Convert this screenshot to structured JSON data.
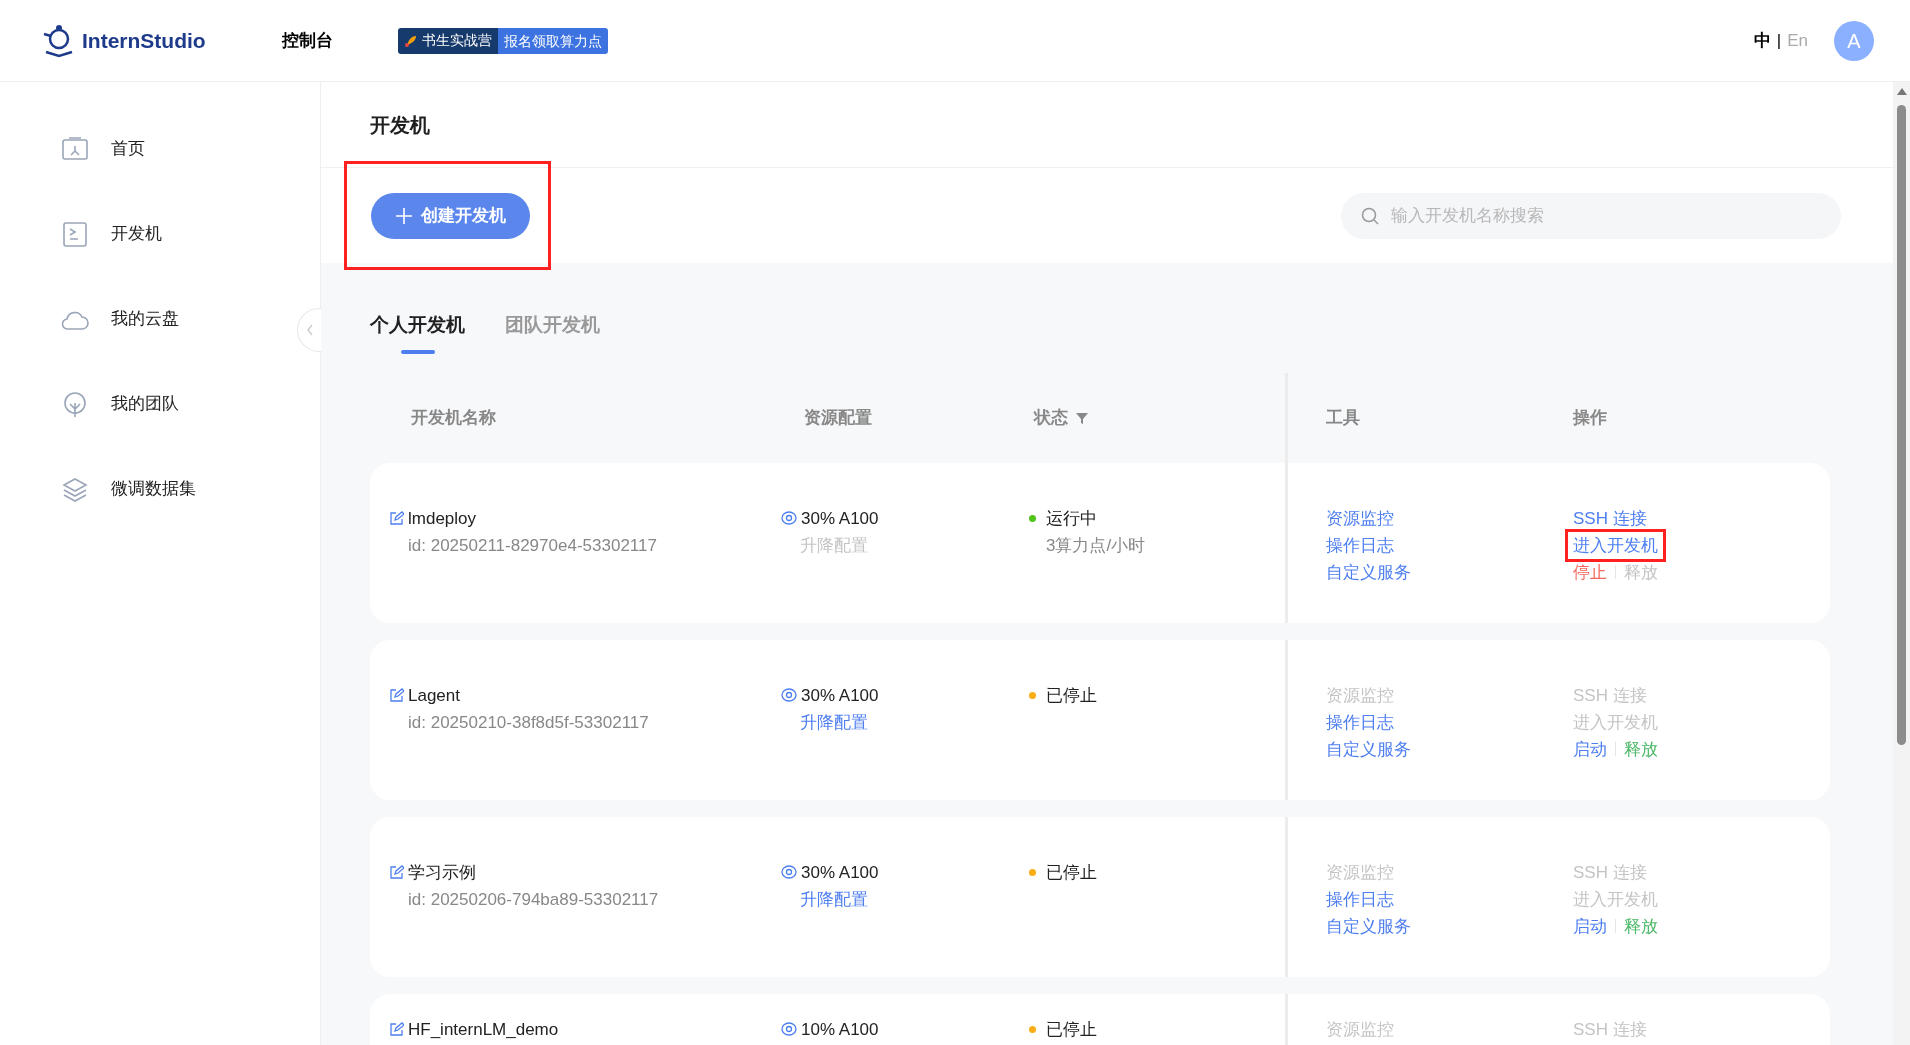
{
  "header": {
    "logo_text": "InternStudio",
    "nav": "控制台",
    "promo": {
      "left": "书生实战营",
      "right": "报名领取算力点"
    },
    "languages": [
      {
        "label": "中",
        "selected": true
      },
      {
        "label": "En",
        "selected": false
      }
    ],
    "separator": "|",
    "avatar": "A"
  },
  "sidebar": {
    "items": [
      {
        "label": "首页",
        "kind": "home"
      },
      {
        "label": "开发机",
        "kind": "terminal"
      },
      {
        "label": "我的云盘",
        "kind": "cloud"
      },
      {
        "label": "我的团队",
        "kind": "tree"
      },
      {
        "label": "微调数据集",
        "kind": "layers"
      }
    ]
  },
  "page_title": "开发机",
  "create_button": {
    "label": "创建开发机",
    "highlighted": true
  },
  "search": {
    "placeholder": "输入开发机名称搜索"
  },
  "tabs": [
    {
      "label": "个人开发机",
      "selected": true
    },
    {
      "label": "团队开发机",
      "selected": false
    }
  ],
  "table": {
    "columns": [
      {
        "label": "开发机名称",
        "filter": false
      },
      {
        "label": "资源配置",
        "filter": false
      },
      {
        "label": "状态",
        "filter": true
      },
      {
        "label": "工具",
        "filter": false
      },
      {
        "label": "操作",
        "filter": false
      }
    ],
    "rows": [
      {
        "name": "lmdeploy",
        "id": "id: 20250211-82970e4-53302117",
        "resource": "30% A100",
        "upgrade": {
          "label": "升降配置",
          "disabled": true
        },
        "status": {
          "label": "运行中",
          "color": "#52c41a"
        },
        "price": "3算力点/小时",
        "tools": [
          {
            "label": "资源监控",
            "disabled": false
          },
          {
            "label": "操作日志",
            "disabled": false
          },
          {
            "label": "自定义服务",
            "disabled": false
          }
        ],
        "actions": [
          [
            {
              "label": "SSH 连接",
              "disabled": false,
              "color": "#4d7ef0",
              "highlighted": false
            }
          ],
          [
            {
              "label": "进入开发机",
              "disabled": false,
              "color": "#4d7ef0",
              "highlighted": true
            }
          ],
          [
            {
              "label": "停止",
              "disabled": false,
              "color": "#f5675d",
              "highlighted": false
            },
            {
              "label": "释放",
              "disabled": true,
              "highlighted": false
            }
          ]
        ]
      },
      {
        "name": "Lagent",
        "id": "id: 20250210-38f8d5f-53302117",
        "resource": "30% A100",
        "upgrade": {
          "label": "升降配置",
          "disabled": false
        },
        "status": {
          "label": "已停止",
          "color": "#faad14"
        },
        "tools": [
          {
            "label": "资源监控",
            "disabled": true
          },
          {
            "label": "操作日志",
            "disabled": false
          },
          {
            "label": "自定义服务",
            "disabled": false
          }
        ],
        "actions": [
          [
            {
              "label": "SSH 连接",
              "disabled": true,
              "highlighted": false
            }
          ],
          [
            {
              "label": "进入开发机",
              "disabled": true,
              "highlighted": false
            }
          ],
          [
            {
              "label": "启动",
              "disabled": false,
              "color": "#4d7ef0",
              "highlighted": false
            },
            {
              "label": "释放",
              "disabled": false,
              "color": "#4ab866",
              "highlighted": false
            }
          ]
        ]
      },
      {
        "name": "学习示例",
        "id": "id: 20250206-794ba89-53302117",
        "resource": "30% A100",
        "upgrade": {
          "label": "升降配置",
          "disabled": false
        },
        "status": {
          "label": "已停止",
          "color": "#faad14"
        },
        "tools": [
          {
            "label": "资源监控",
            "disabled": true
          },
          {
            "label": "操作日志",
            "disabled": false
          },
          {
            "label": "自定义服务",
            "disabled": false
          }
        ],
        "actions": [
          [
            {
              "label": "SSH 连接",
              "disabled": true,
              "highlighted": false
            }
          ],
          [
            {
              "label": "进入开发机",
              "disabled": true,
              "highlighted": false
            }
          ],
          [
            {
              "label": "启动",
              "disabled": false,
              "color": "#4d7ef0",
              "highlighted": false
            },
            {
              "label": "释放",
              "disabled": false,
              "color": "#4ab866",
              "highlighted": false
            }
          ]
        ]
      },
      {
        "name": "HF_internLM_demo",
        "resource": "10% A100",
        "status": {
          "label": "已停止",
          "color": "#faad14"
        },
        "tools": [
          {
            "label": "资源监控",
            "disabled": true
          }
        ],
        "actions": [
          [
            {
              "label": "SSH 连接",
              "disabled": true,
              "highlighted": false
            }
          ]
        ]
      }
    ]
  }
}
